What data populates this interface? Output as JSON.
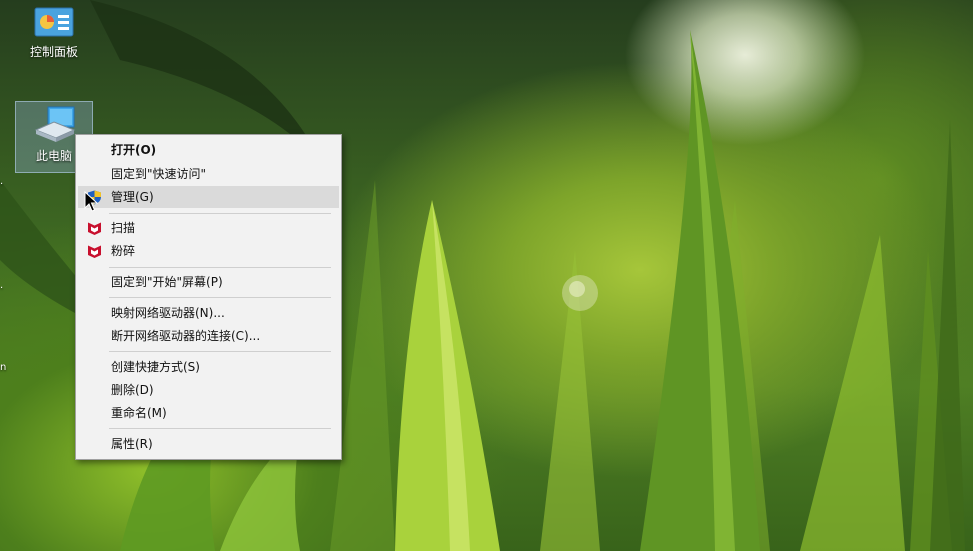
{
  "desktop": {
    "icons": [
      {
        "label": "控制面板",
        "icon": "control-panel-icon",
        "selected": false
      },
      {
        "label": "此电脑",
        "icon": "computer-icon",
        "selected": true
      }
    ]
  },
  "context_menu": {
    "items": [
      {
        "label": "打开(O)",
        "bold": true
      },
      {
        "label": "固定到\"快速访问\""
      },
      {
        "label": "管理(G)",
        "icon": "shield-icon",
        "hovered": true
      },
      {
        "label": "扫描",
        "icon": "mcafee-icon"
      },
      {
        "label": "粉碎",
        "icon": "mcafee-icon"
      },
      {
        "label": "固定到\"开始\"屏幕(P)"
      },
      {
        "label": "映射网络驱动器(N)..."
      },
      {
        "label": "断开网络驱动器的连接(C)..."
      },
      {
        "label": "创建快捷方式(S)"
      },
      {
        "label": "删除(D)"
      },
      {
        "label": "重命名(M)"
      },
      {
        "label": "属性(R)"
      }
    ]
  },
  "colors": {
    "menu_bg": "#f2f2f2",
    "menu_hover": "#dadada",
    "mcafee_red": "#c8102e"
  }
}
